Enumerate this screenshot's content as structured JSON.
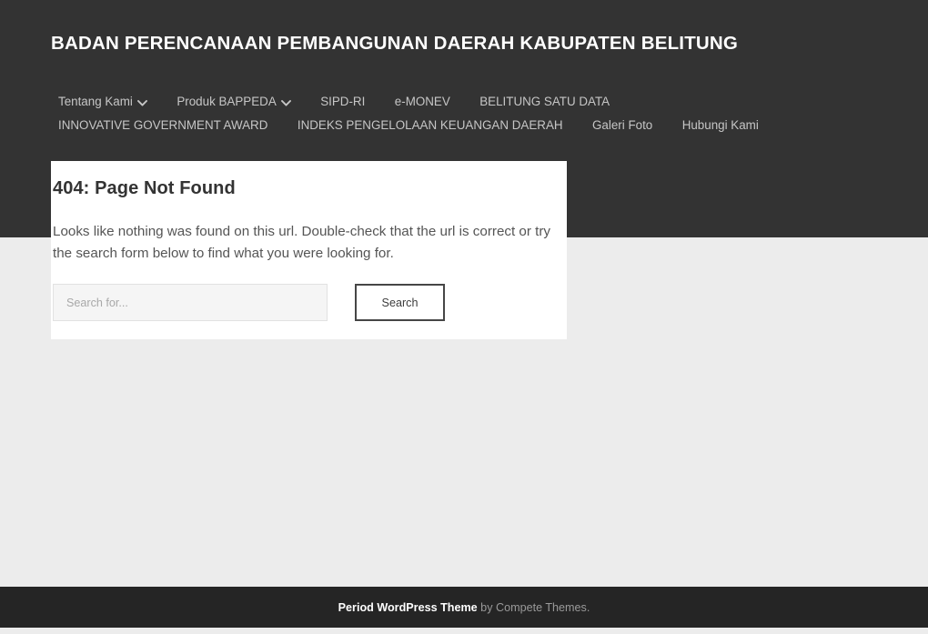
{
  "site": {
    "title": "BADAN PERENCANAAN PEMBANGUNAN DAERAH KABUPATEN BELITUNG",
    "header_bg": "#333333",
    "page_bg": "#ececec"
  },
  "nav": {
    "items": [
      {
        "label": "Tentang Kami",
        "has_dropdown": true
      },
      {
        "label": "Produk BAPPEDA",
        "has_dropdown": true
      },
      {
        "label": "SIPD-RI",
        "has_dropdown": false
      },
      {
        "label": "e-MONEV",
        "has_dropdown": false
      },
      {
        "label": "BELITUNG SATU DATA",
        "has_dropdown": false
      },
      {
        "label": "INNOVATIVE GOVERNMENT AWARD",
        "has_dropdown": false
      },
      {
        "label": "INDEKS PENGELOLAAN KEUANGAN DAERAH",
        "has_dropdown": false
      },
      {
        "label": "Galeri Foto",
        "has_dropdown": false
      },
      {
        "label": "Hubungi Kami",
        "has_dropdown": false
      }
    ]
  },
  "main": {
    "error_title": "404: Page Not Found",
    "error_text": "Looks like nothing was found on this url. Double-check that the url is correct or try the search form below to find what you were looking for.",
    "search": {
      "placeholder": "Search for...",
      "value": "",
      "submit_label": "Search"
    }
  },
  "footer": {
    "theme_name": "Period WordPress Theme",
    "credit_suffix": " by Compete Themes."
  }
}
